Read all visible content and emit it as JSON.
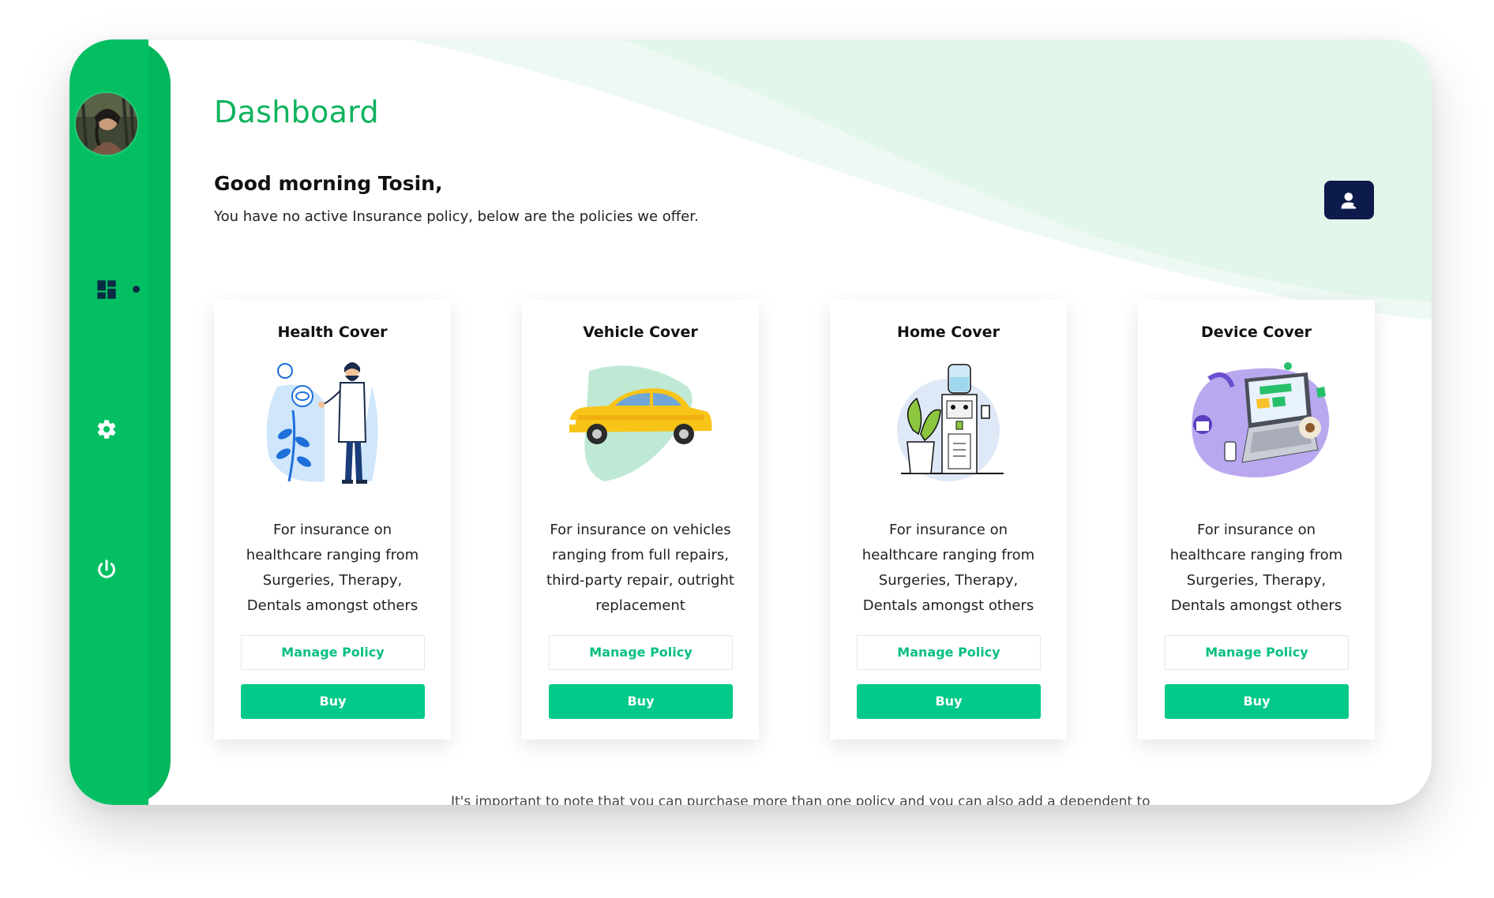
{
  "page": {
    "title": "Dashboard",
    "greeting": "Good morning Tosin,",
    "subtext": "You have no active Insurance policy, below are the policies we offer.",
    "footnote": "It's important to note that you can purchase more than one policy and you can also add a dependent to"
  },
  "sidebar": {
    "items": [
      {
        "icon": "dashboard-icon",
        "active": true
      },
      {
        "icon": "gear-icon",
        "active": false
      },
      {
        "icon": "power-icon",
        "active": false
      }
    ]
  },
  "cards": [
    {
      "title": "Health Cover",
      "description": "For insurance on healthcare ranging from Surgeries, Therapy, Dentals amongst others",
      "manage_label": "Manage Policy",
      "buy_label": "Buy",
      "illustration": "doctor-illustration"
    },
    {
      "title": "Vehicle Cover",
      "description": "For insurance on vehicles ranging from full repairs, third-party repair, outright replacement",
      "manage_label": "Manage Policy",
      "buy_label": "Buy",
      "illustration": "car-illustration"
    },
    {
      "title": "Home Cover",
      "description": "For insurance on healthcare ranging from Surgeries, Therapy, Dentals amongst others",
      "manage_label": "Manage Policy",
      "buy_label": "Buy",
      "illustration": "home-illustration"
    },
    {
      "title": "Device Cover",
      "description": "For insurance on healthcare ranging from Surgeries, Therapy, Dentals amongst others",
      "manage_label": "Manage Policy",
      "buy_label": "Buy",
      "illustration": "laptop-illustration"
    }
  ],
  "colors": {
    "primary_green": "#03bf62",
    "title_green": "#0fb35d",
    "button_green": "#03c98a",
    "navy": "#0d1b4c"
  }
}
